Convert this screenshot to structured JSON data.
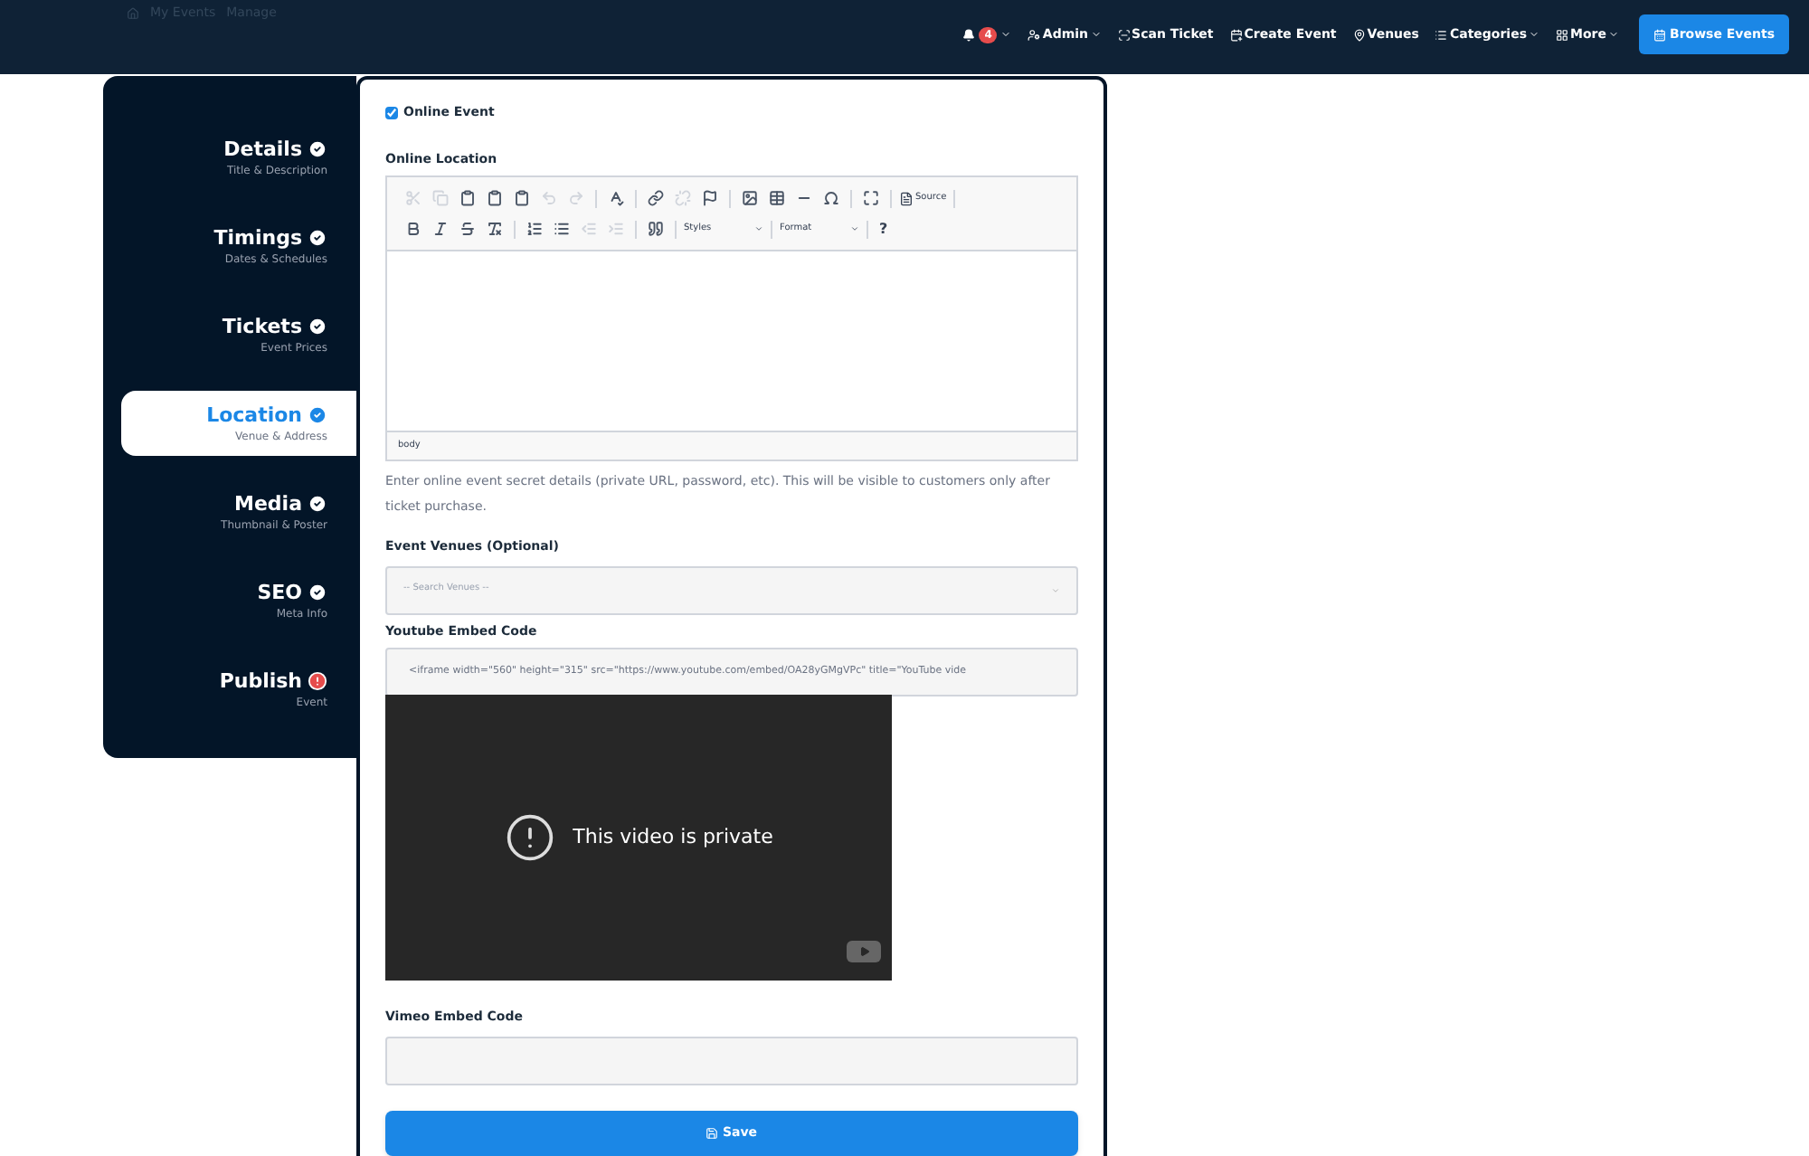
{
  "breadcrumbs": [
    "My Events",
    "Manage"
  ],
  "nav": {
    "notification_count": "4",
    "items": [
      {
        "label": "Admin",
        "kind": "user",
        "dropdown": true
      },
      {
        "label": "Scan Ticket",
        "kind": "scan",
        "dropdown": false
      },
      {
        "label": "Create Event",
        "kind": "calendar",
        "dropdown": false
      },
      {
        "label": "Venues",
        "kind": "pin",
        "dropdown": false
      },
      {
        "label": "Categories",
        "kind": "list",
        "dropdown": true
      },
      {
        "label": "More",
        "kind": "grid",
        "dropdown": true
      }
    ],
    "cta": "Browse Events"
  },
  "steps": [
    {
      "title": "Details",
      "subtitle": "Title & Description",
      "selected": false,
      "kind": "done"
    },
    {
      "title": "Timings",
      "subtitle": "Dates & Schedules",
      "selected": false,
      "kind": "done"
    },
    {
      "title": "Tickets",
      "subtitle": "Event Prices",
      "selected": false,
      "kind": "done"
    },
    {
      "title": "Location",
      "subtitle": "Venue & Address",
      "selected": true,
      "kind": "done"
    },
    {
      "title": "Media",
      "subtitle": "Thumbnail & Poster",
      "selected": false,
      "kind": "done"
    },
    {
      "title": "SEO",
      "subtitle": "Meta Info",
      "selected": false,
      "kind": "done"
    },
    {
      "title": "Publish",
      "subtitle": "Event",
      "selected": false,
      "kind": "error"
    }
  ],
  "online_event": {
    "label": "Online Event",
    "checked": true
  },
  "online_location": {
    "label": "Online Location",
    "source": "Source",
    "styles": "Styles",
    "format": "Format",
    "help": "?",
    "path": "body",
    "hint": "Enter online event secret details (private URL, password, etc). This will be visible to customers only after ticket purchase."
  },
  "venues": {
    "label": "Event Venues (Optional)",
    "placeholder": "-- Search Venues --"
  },
  "youtube": {
    "label": "Youtube Embed Code",
    "value": "<iframe width=\"560\" height=\"315\" src=\"https://www.youtube.com/embed/OA28yGMgVPc\" title=\"YouTube vide",
    "player_message": "This video is private"
  },
  "vimeo": {
    "label": "Vimeo Embed Code"
  },
  "save": "Save"
}
